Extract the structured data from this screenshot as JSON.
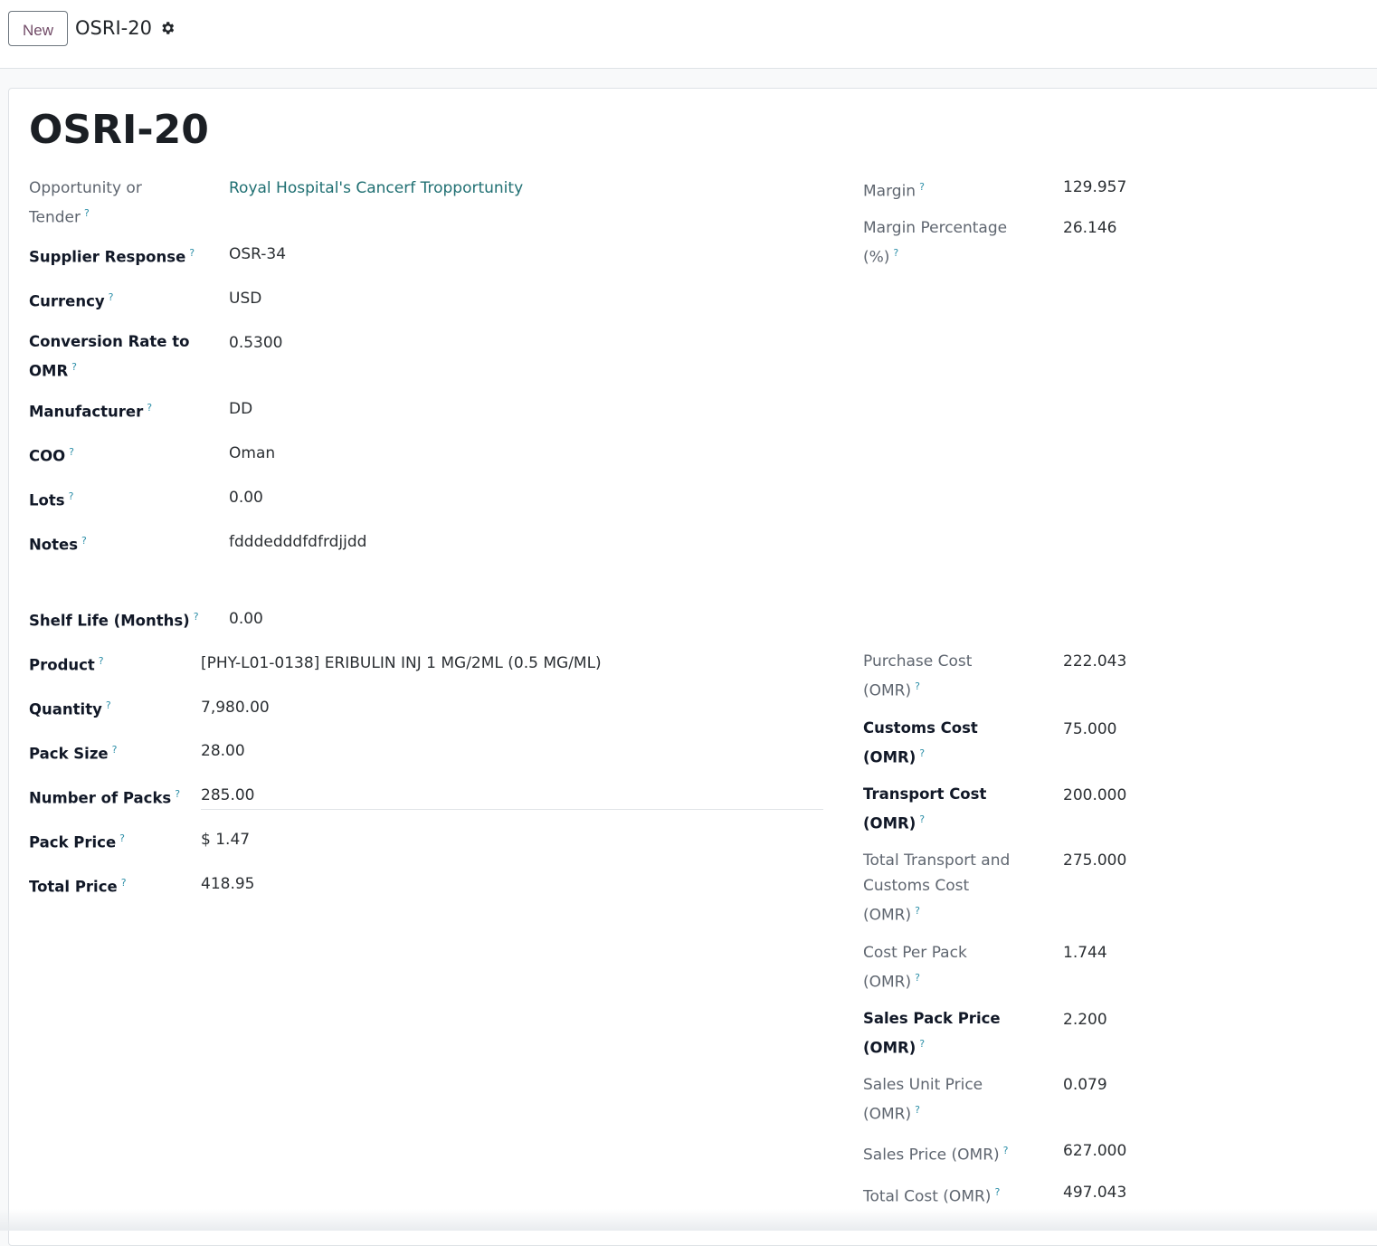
{
  "toolbar": {
    "new_label": "New",
    "breadcrumb": "OSRI-20"
  },
  "record": {
    "title": "OSRI-20"
  },
  "left_fields": {
    "opportunity": {
      "label_1": "Opportunity or",
      "label_2": "Tender",
      "value": "Royal Hospital's Cancerf Tropportunity"
    },
    "supplier_response": {
      "label": "Supplier Response",
      "value": "OSR-34"
    },
    "currency": {
      "label": "Currency",
      "value": "USD"
    },
    "conversion_rate": {
      "label_1": "Conversion Rate to",
      "label_2": "OMR",
      "value": "0.5300"
    },
    "manufacturer": {
      "label": "Manufacturer",
      "value": "DD"
    },
    "coo": {
      "label": "COO",
      "value": "Oman"
    },
    "lots": {
      "label": "Lots",
      "value": "0.00"
    },
    "notes": {
      "label": "Notes",
      "value": "fdddedddfdfrdjjdd"
    },
    "shelf_life": {
      "label": "Shelf Life (Months)",
      "value": "0.00"
    }
  },
  "product_fields": {
    "product": {
      "label": "Product",
      "value": "[PHY-L01-0138] ERIBULIN INJ 1 MG/2ML (0.5 MG/ML)"
    },
    "quantity": {
      "label": "Quantity",
      "value": "7,980.00"
    },
    "pack_size": {
      "label": "Pack Size",
      "value": "28.00"
    },
    "number_of_packs": {
      "label": "Number of Packs",
      "value": "285.00"
    },
    "pack_price": {
      "label": "Pack Price",
      "value": "$ 1.47"
    },
    "total_price": {
      "label": "Total Price",
      "value": "418.95"
    }
  },
  "margin_fields": {
    "margin": {
      "label": "Margin",
      "value": "129.957"
    },
    "margin_pct": {
      "label_1": "Margin Percentage",
      "label_2": "(%)",
      "value": "26.146"
    }
  },
  "cost_fields": {
    "purchase_cost": {
      "label_1": "Purchase Cost",
      "label_2": "(OMR)",
      "value": "222.043"
    },
    "customs_cost": {
      "label_1": "Customs Cost",
      "label_2": "(OMR)",
      "value": "75.000"
    },
    "transport_cost": {
      "label_1": "Transport Cost",
      "label_2": "(OMR)",
      "value": "200.000"
    },
    "total_transport_customs": {
      "label_1": "Total Transport and",
      "label_2": "Customs Cost",
      "label_3": "(OMR)",
      "value": "275.000"
    },
    "cost_per_pack": {
      "label_1": "Cost Per Pack",
      "label_2": "(OMR)",
      "value": "1.744"
    },
    "sales_pack_price": {
      "label_1": "Sales Pack Price",
      "label_2": "(OMR)",
      "value": "2.200"
    },
    "sales_unit_price": {
      "label_1": "Sales Unit Price",
      "label_2": "(OMR)",
      "value": "0.079"
    },
    "sales_price": {
      "label": "Sales Price (OMR)",
      "value": "627.000"
    },
    "total_cost": {
      "label": "Total Cost (OMR)",
      "value": "497.043"
    }
  },
  "help_marker": "?",
  "colors": {
    "link": "#1f6f72",
    "help": "#2d8fa8",
    "button_text": "#714b67"
  },
  "icons": [
    "gear-icon",
    "help-icon"
  ]
}
